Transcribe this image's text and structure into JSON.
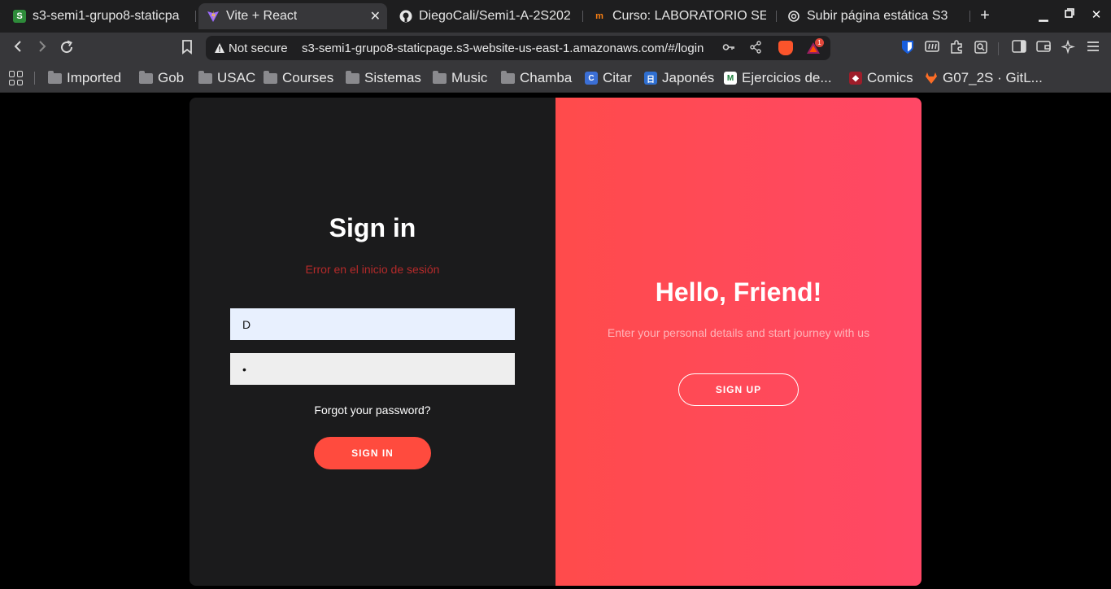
{
  "tabs": [
    {
      "title": "s3-semi1-grupo8-staticpa",
      "favicon": "s3-bucket-icon"
    },
    {
      "title": "Vite + React",
      "favicon": "vite-icon",
      "close": "✕"
    },
    {
      "title": "DiegoCali/Semi1-A-2S202",
      "favicon": "github-icon"
    },
    {
      "title": "Curso: LABORATORIO SEI",
      "favicon": "moodle-icon"
    },
    {
      "title": "Subir página estática S3",
      "favicon": "openai-icon"
    }
  ],
  "address": {
    "security": "Not secure",
    "url": "s3-semi1-grupo8-staticpage.s3-website-us-east-1.amazonaws.com/#/login",
    "shields_badge": "1"
  },
  "bookmarks": [
    {
      "label": "Imported"
    },
    {
      "label": "Gob"
    },
    {
      "label": "USAC"
    },
    {
      "label": "Courses"
    },
    {
      "label": "Sistemas"
    },
    {
      "label": "Music"
    },
    {
      "label": "Chamba"
    },
    {
      "label": "Citar"
    },
    {
      "label": "Japonés"
    },
    {
      "label": "Ejercicios de..."
    },
    {
      "label": "Comics"
    },
    {
      "label": "G07_2S · GitL..."
    }
  ],
  "signin": {
    "title": "Sign in",
    "error": "Error en el inicio de sesión",
    "username_value": "D",
    "password_value": "•",
    "forgot": "Forgot your password?",
    "button": "SIGN IN"
  },
  "overlay": {
    "title": "Hello, Friend!",
    "subtitle": "Enter your personal details and start journey with us",
    "button": "SIGN UP"
  },
  "colors": {
    "accent": "#ff4b3e",
    "panel_dark": "#1b1b1c",
    "error": "#b52a2a"
  }
}
